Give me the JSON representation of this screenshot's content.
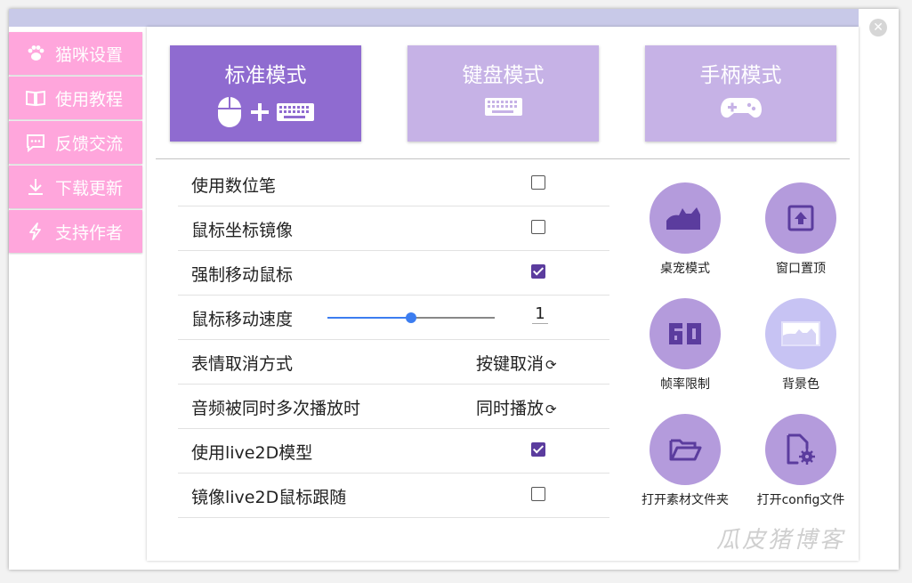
{
  "sidebar": {
    "items": [
      {
        "label": "猫咪设置",
        "icon": "paw-icon"
      },
      {
        "label": "使用教程",
        "icon": "book-icon"
      },
      {
        "label": "反馈交流",
        "icon": "chat-icon"
      },
      {
        "label": "下载更新",
        "icon": "download-icon"
      },
      {
        "label": "支持作者",
        "icon": "bolt-icon"
      }
    ]
  },
  "modes": [
    {
      "label": "标准模式",
      "icon": "mouse-plus-keyboard-icon",
      "selected": true
    },
    {
      "label": "键盘模式",
      "icon": "keyboard-icon",
      "selected": false
    },
    {
      "label": "手柄模式",
      "icon": "gamepad-icon",
      "selected": false
    }
  ],
  "settings": {
    "digital_pen": {
      "label": "使用数位笔",
      "checked": false
    },
    "mouse_mirror": {
      "label": "鼠标坐标镜像",
      "checked": false
    },
    "force_move": {
      "label": "强制移动鼠标",
      "checked": true
    },
    "mouse_speed": {
      "label": "鼠标移动速度",
      "value": "1",
      "slider_fraction": 0.5
    },
    "emote_cancel": {
      "label": "表情取消方式",
      "value": "按键取消"
    },
    "audio_overlap": {
      "label": "音频被同时多次播放时",
      "value": "同时播放"
    },
    "use_live2d": {
      "label": "使用live2D模型",
      "checked": true
    },
    "mirror_live2d": {
      "label": "镜像live2D鼠标跟随",
      "checked": false
    }
  },
  "feature_buttons": {
    "pet_mode": {
      "label": "桌宠模式",
      "icon": "cat-silhouette-icon"
    },
    "window_top": {
      "label": "窗口置顶",
      "icon": "pin-top-icon"
    },
    "fps_limit": {
      "label": "帧率限制",
      "icon": "fps-60-icon"
    },
    "bg_color": {
      "label": "背景色",
      "icon": "background-image-icon"
    },
    "open_folder": {
      "label": "打开素材文件夹",
      "icon": "folder-open-icon"
    },
    "open_config": {
      "label": "打开config文件",
      "icon": "file-gear-icon"
    }
  },
  "watermark": "瓜皮猪博客",
  "colors": {
    "sidebar_pink": "#ffa6dc",
    "mode_active": "#8f6bd0",
    "mode_inactive": "#c6b2e6",
    "feature_circle": "#b49bdc",
    "feature_circle_light": "#c7c3f3",
    "checkbox_checked": "#5b3c9e",
    "slider_blue": "#3c7df0"
  }
}
